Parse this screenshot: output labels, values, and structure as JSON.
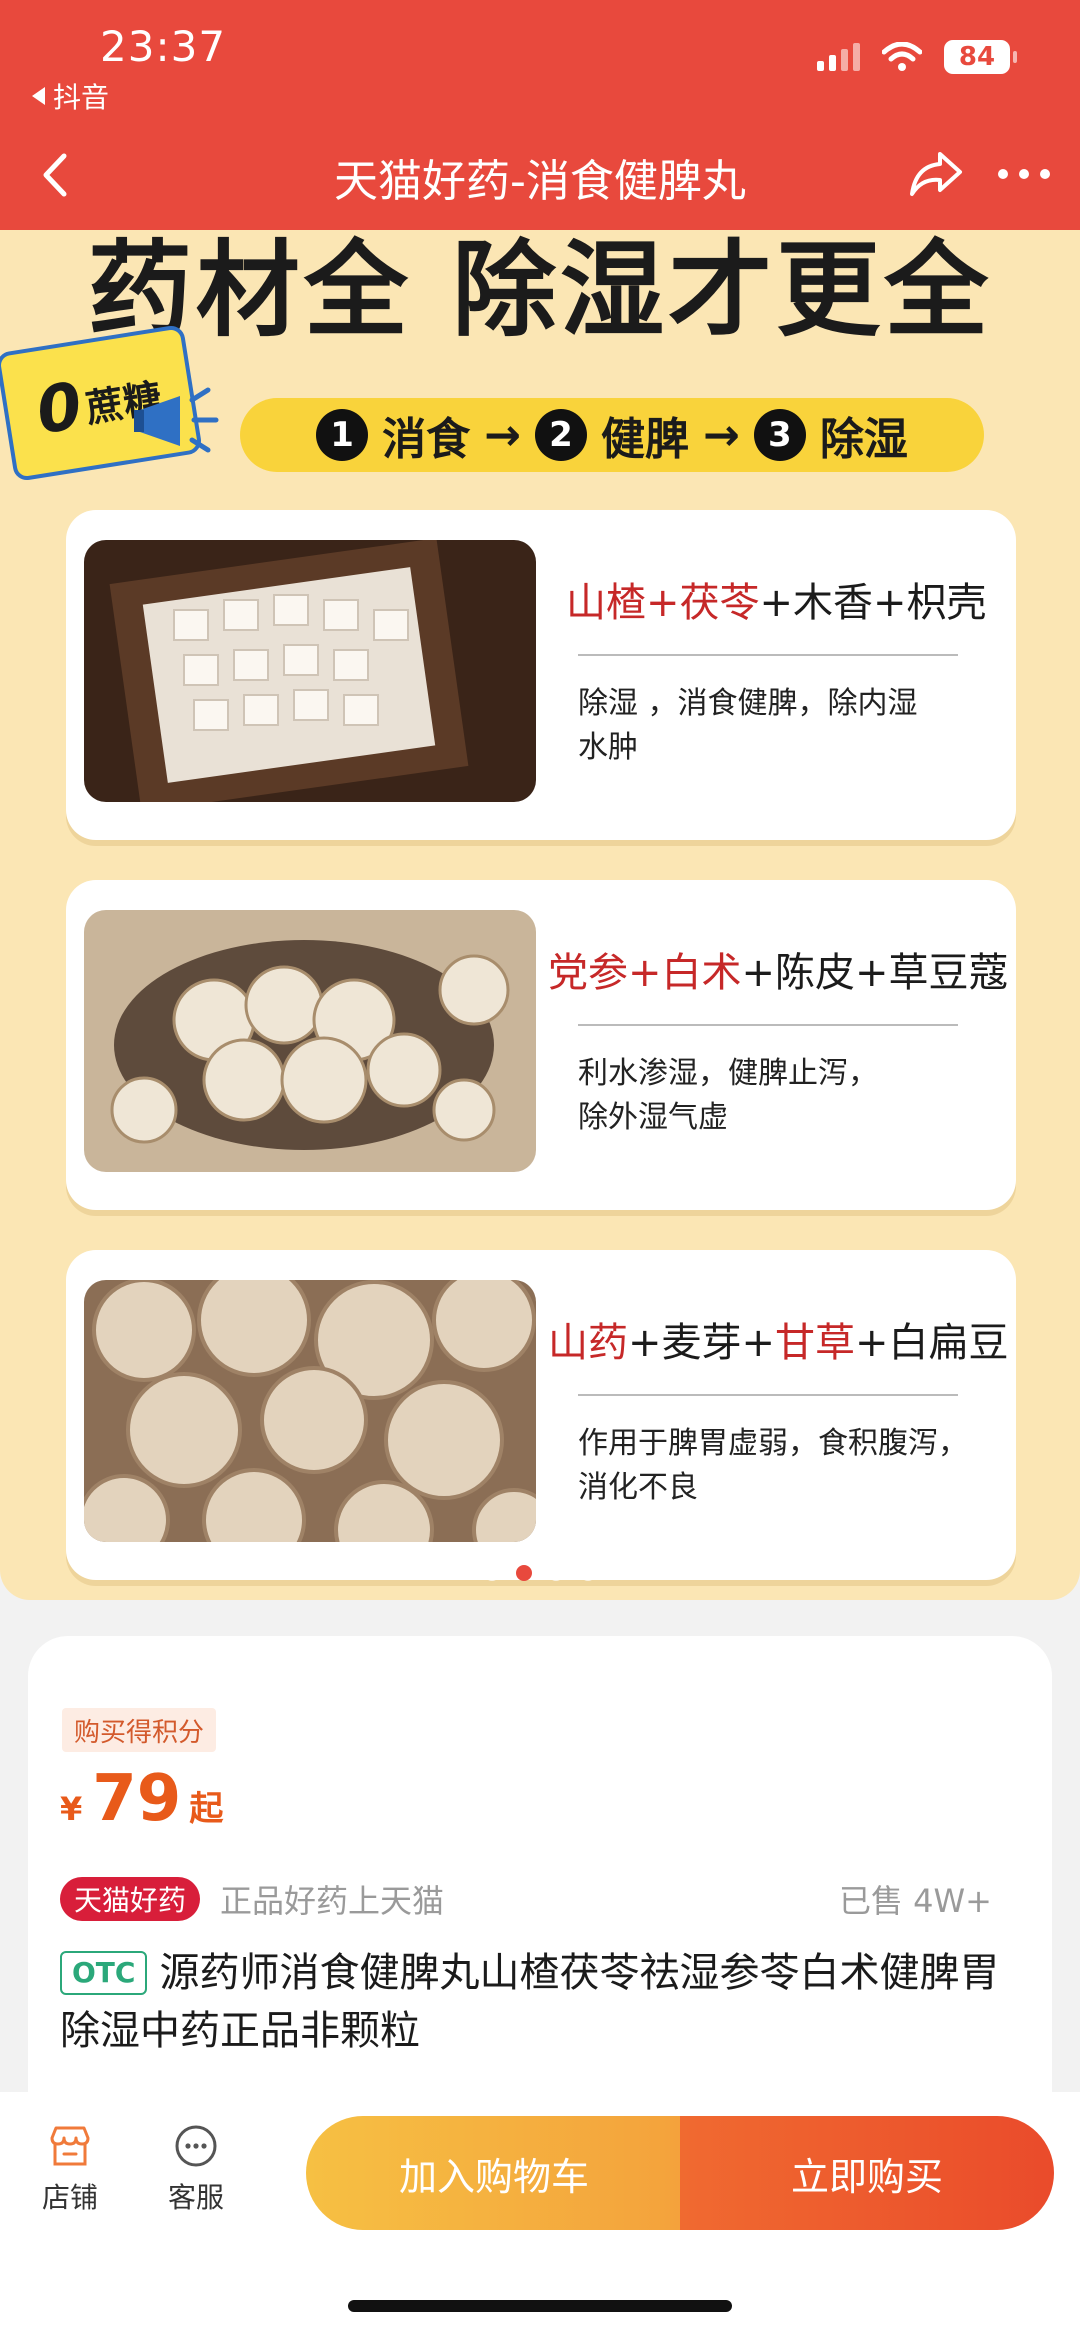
{
  "status": {
    "time": "23:37",
    "back_app": "抖音",
    "battery": "84"
  },
  "nav": {
    "title": "天猫好药-消食健脾丸"
  },
  "banner": {
    "title": "药材全 除湿才更全",
    "sticker": {
      "zero": "0",
      "text": "蔗糖"
    },
    "steps": [
      {
        "num": "1",
        "label": "消食"
      },
      {
        "num": "2",
        "label": "健脾"
      },
      {
        "num": "3",
        "label": "除湿"
      }
    ],
    "arrow": "→",
    "cards": [
      {
        "h1": "山楂+茯苓",
        "h2": "+木香+枳壳",
        "effect_1": "除湿 ，消食健脾，除内湿",
        "effect_2": "水肿"
      },
      {
        "h1": "党参+白术",
        "h2": "+陈皮+草豆蔻",
        "effect_1": "利水渗湿，健脾止泻，",
        "effect_2": "除外湿气虚"
      },
      {
        "h1": "山药",
        "h2": "+麦芽+",
        "h3": "甘草",
        "h4": "+白扁豆",
        "effect_1": "作用于脾胃虚弱，食积腹泻，",
        "effect_2": "消化不良"
      }
    ]
  },
  "product": {
    "points_tag": "购买得积分",
    "price_symbol": "¥",
    "price": "79",
    "price_suffix": "起",
    "brand_tag": "天猫好药",
    "slogan": "正品好药上天猫",
    "sold": "已售 4W+",
    "otc": "OTC",
    "title": "源药师消食健脾丸山楂茯苓祛湿参苓白术健脾胃除湿中药正品非颗粒"
  },
  "bottom": {
    "shop": "店铺",
    "service": "客服",
    "add_cart": "加入购物车",
    "buy_now": "立即购买"
  },
  "colors": {
    "brand_red": "#e8493d",
    "banner_bg": "#fbe6b4",
    "price_orange": "#e85a1a",
    "tmall_red": "#d81e3a"
  }
}
